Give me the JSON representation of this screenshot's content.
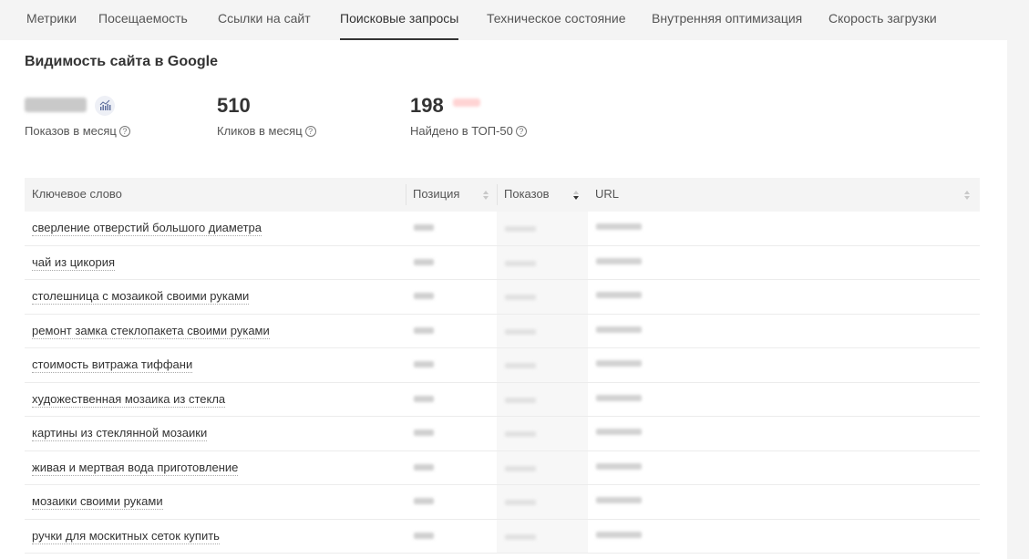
{
  "tabs": [
    {
      "label": "Метрики"
    },
    {
      "label": "Посещаемость"
    },
    {
      "label": "Ссылки на сайт"
    },
    {
      "label": "Поисковые запросы"
    },
    {
      "label": "Техническое состояние"
    },
    {
      "label": "Внутренняя оптимизация"
    },
    {
      "label": "Скорость загрузки"
    }
  ],
  "active_tab": "Поисковые запросы",
  "section": {
    "title": "Видимость сайта в Google"
  },
  "metrics": {
    "impressions": {
      "label": "Показов в месяц"
    },
    "clicks": {
      "value": "510",
      "label": "Кликов в месяц"
    },
    "top50": {
      "value": "198",
      "label": "Найдено в ТОП-50"
    }
  },
  "table": {
    "columns": {
      "keyword": "Ключевое слово",
      "position": "Позиция",
      "impressions": "Показов",
      "url": "URL"
    },
    "rows": [
      {
        "keyword": "сверление отверстий большого диаметра"
      },
      {
        "keyword": "чай из цикория"
      },
      {
        "keyword": "столешница с мозаикой своими руками"
      },
      {
        "keyword": "ремонт замка стеклопакета своими руками"
      },
      {
        "keyword": "стоимость витража тиффани"
      },
      {
        "keyword": "художественная мозаика из стекла"
      },
      {
        "keyword": "картины из стеклянной мозаики"
      },
      {
        "keyword": "живая и мертвая вода приготовление"
      },
      {
        "keyword": "мозаики своими руками"
      },
      {
        "keyword": "ручки для москитных сеток купить"
      }
    ]
  },
  "icons": {
    "chart": "bar-chart-icon",
    "help": "question-circle-icon",
    "sort": "sort-arrows-icon"
  },
  "colors": {
    "accent": "#333333",
    "delta_negative": "#ff6b6b",
    "header_bg": "#f4f4f4"
  }
}
